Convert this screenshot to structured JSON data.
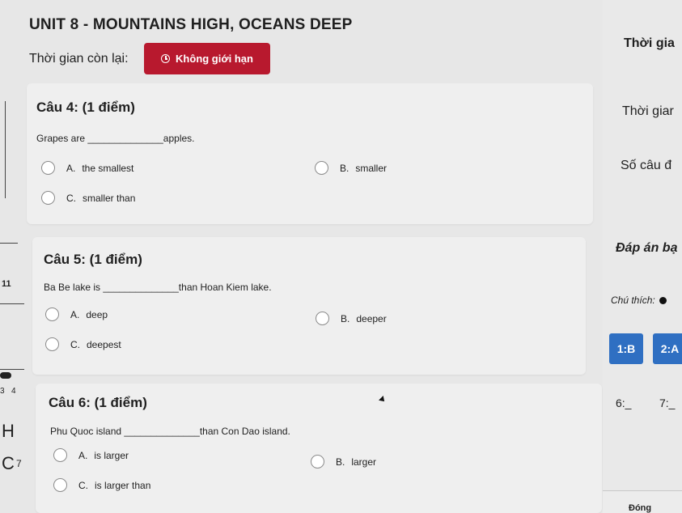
{
  "header": {
    "title": "UNIT 8 - MOUNTAINS HIGH, OCEANS DEEP",
    "timer_label": "Thời gian còn lại:",
    "timer_value": "Không giới hạn"
  },
  "questions": [
    {
      "title": "Câu 4: (1 điểm)",
      "text": "Grapes are ______________apples.",
      "options": [
        {
          "letter": "A.",
          "label": "the smallest"
        },
        {
          "letter": "B.",
          "label": "smaller"
        },
        {
          "letter": "C.",
          "label": "smaller than"
        }
      ]
    },
    {
      "title": "Câu 5: (1 điểm)",
      "text": "Ba Be lake is ______________than Hoan Kiem lake.",
      "options": [
        {
          "letter": "A.",
          "label": "deep"
        },
        {
          "letter": "B.",
          "label": "deeper"
        },
        {
          "letter": "C.",
          "label": "deepest"
        }
      ]
    },
    {
      "title": "Câu 6: (1 điểm)",
      "text": "Phu Quoc island ______________than Con Dao island.",
      "options": [
        {
          "letter": "A.",
          "label": "is larger"
        },
        {
          "letter": "B.",
          "label": "larger"
        },
        {
          "letter": "C.",
          "label": "is larger than"
        }
      ]
    }
  ],
  "sidebar": {
    "time_heading": "Thời gia",
    "time_sub": "Thời giar",
    "count_label": "Số câu đ",
    "answer_heading": "Đáp án bạ",
    "note_label": "Chú thích:",
    "answers": [
      {
        "label": "1:B",
        "color": "#2f6fc2"
      },
      {
        "label": "2:A",
        "color": "#2f6fc2"
      }
    ],
    "pending": [
      "6:_",
      "7:_"
    ],
    "close_label": "Đóng"
  },
  "edge_marks": [
    "11",
    "3",
    "4",
    "H",
    "C",
    "7"
  ],
  "colors": {
    "accent": "#b8192e",
    "answered": "#2f6fc2"
  }
}
